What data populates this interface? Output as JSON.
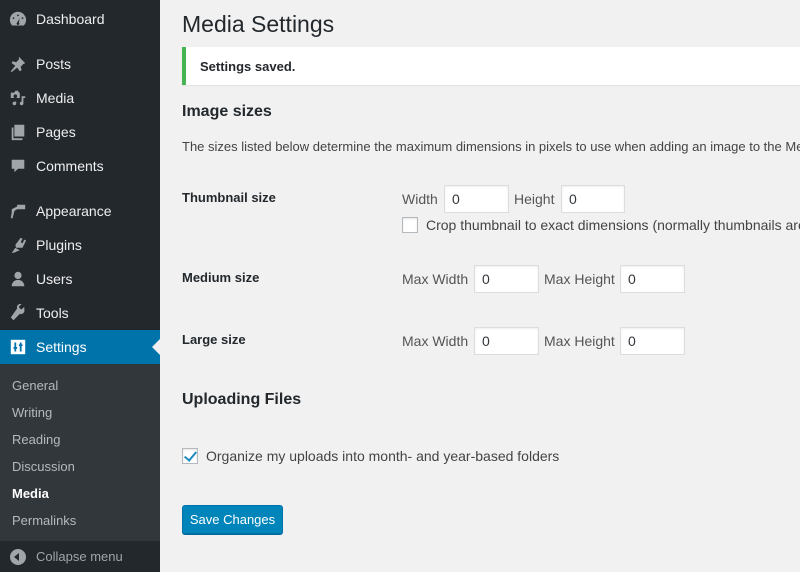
{
  "sidebar": {
    "items": [
      {
        "label": "Dashboard",
        "icon": "dashboard-icon"
      },
      {
        "label": "Posts",
        "icon": "pin-icon"
      },
      {
        "label": "Media",
        "icon": "media-icon"
      },
      {
        "label": "Pages",
        "icon": "pages-icon"
      },
      {
        "label": "Comments",
        "icon": "comment-icon"
      },
      {
        "label": "Appearance",
        "icon": "paintbrush-icon"
      },
      {
        "label": "Plugins",
        "icon": "plugin-icon"
      },
      {
        "label": "Users",
        "icon": "user-icon"
      },
      {
        "label": "Tools",
        "icon": "wrench-icon"
      },
      {
        "label": "Settings",
        "icon": "settings-sliders-icon",
        "active": true
      }
    ],
    "submenu": [
      {
        "label": "General"
      },
      {
        "label": "Writing"
      },
      {
        "label": "Reading"
      },
      {
        "label": "Discussion"
      },
      {
        "label": "Media",
        "current": true
      },
      {
        "label": "Permalinks"
      }
    ],
    "collapse_label": "Collapse menu"
  },
  "page": {
    "title": "Media Settings",
    "notice": "Settings saved.",
    "image_sizes_heading": "Image sizes",
    "image_sizes_desc": "The sizes listed below determine the maximum dimensions in pixels to use when adding an image to the Media Library.",
    "thumbnail": {
      "label": "Thumbnail size",
      "width_label": "Width",
      "width_value": "0",
      "height_label": "Height",
      "height_value": "0",
      "crop_label": "Crop thumbnail to exact dimensions (normally thumbnails are proportional)",
      "crop_checked": false
    },
    "medium": {
      "label": "Medium size",
      "width_label": "Max Width",
      "width_value": "0",
      "height_label": "Max Height",
      "height_value": "0"
    },
    "large": {
      "label": "Large size",
      "width_label": "Max Width",
      "width_value": "0",
      "height_label": "Max Height",
      "height_value": "0"
    },
    "uploading_heading": "Uploading Files",
    "organize_label": "Organize my uploads into month- and year-based folders",
    "organize_checked": true,
    "save_label": "Save Changes"
  },
  "colors": {
    "sidebar_bg": "#23282d",
    "submenu_bg": "#32373c",
    "active_blue": "#0073aa",
    "button_blue": "#0085ba",
    "notice_green": "#46b450",
    "page_bg": "#f1f1f1"
  }
}
